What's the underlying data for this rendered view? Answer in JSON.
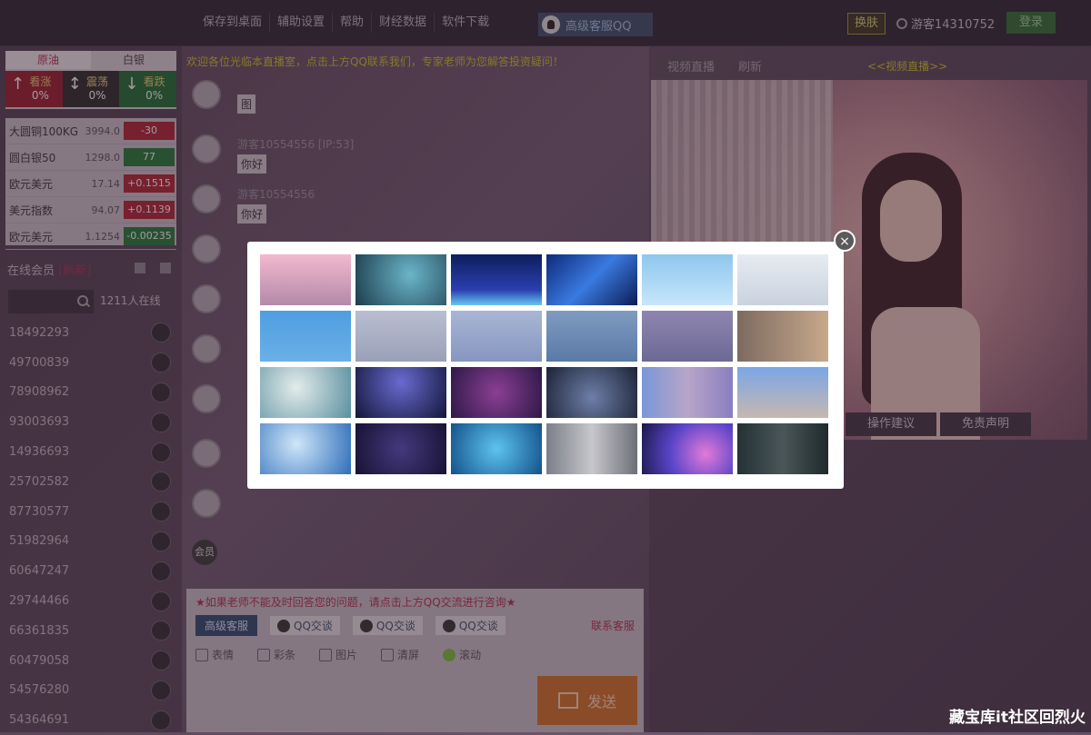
{
  "topbar": {
    "nav": [
      "保存到桌面",
      "辅助设置",
      "帮助",
      "财经数据",
      "软件下载"
    ],
    "qq_service": "高级客服QQ",
    "skin": "换肤",
    "user": "游客14310752",
    "login": "登录"
  },
  "quote": {
    "tabs": [
      "原油",
      "白银"
    ],
    "sentiment": [
      {
        "label": "看涨",
        "pct": "0%",
        "arrow": "↑"
      },
      {
        "label": "震荡",
        "pct": "0%",
        "arrow": "↕"
      },
      {
        "label": "看跌",
        "pct": "0%",
        "arrow": "↓"
      }
    ]
  },
  "markets": [
    {
      "name": "大圆铜100KG",
      "price": "3994.0",
      "change": "-30",
      "color": "red"
    },
    {
      "name": "圆白银50",
      "price": "1298.0",
      "change": "77",
      "color": "green"
    },
    {
      "name": "欧元美元",
      "price": "17.14",
      "change": "+0.1515",
      "color": "red"
    },
    {
      "name": "美元指数",
      "price": "94.07",
      "change": "+0.1139",
      "color": "red"
    },
    {
      "name": "欧元美元",
      "price": "1.1254",
      "change": "-0.00235",
      "color": "green"
    }
  ],
  "online": {
    "title": "在线会员",
    "title_tag": "[刷新]",
    "count": "1211人在线",
    "members": [
      "18492293",
      "49700839",
      "78908962",
      "93003693",
      "14936693",
      "25702582",
      "87730577",
      "51982964",
      "60647247",
      "29744466",
      "66361835",
      "60479058",
      "54576280",
      "54364691"
    ]
  },
  "chat": {
    "marquee": "欢迎各位光临本直播室，点击上方QQ联系我们，专家老师为您解答投资疑问！",
    "messages": [
      {
        "name": "",
        "text": "图"
      },
      {
        "name": "游客10554556 [IP:53]",
        "text": "你好"
      },
      {
        "name": "游客10554556",
        "text": "你好"
      }
    ],
    "member_label": "会员",
    "notice": "★如果老师不能及时回答您的问题，请点击上方QQ交流进行咨询★",
    "service_btn": "高级客服",
    "qq_chat": [
      "QQ交谈",
      "QQ交谈",
      "QQ交谈"
    ],
    "cs_link": "联系客服",
    "tools": [
      "表情",
      "彩条",
      "图片",
      "清屏",
      "滚动"
    ],
    "send": "发送"
  },
  "video": {
    "tabs": [
      "视频直播",
      "刷新"
    ],
    "title": "<<视频直播>>",
    "info_tabs": [
      "操作建议",
      "免责声明"
    ]
  },
  "skin_modal": {
    "close": "×",
    "thumbnails": 24
  },
  "watermark": "藏宝库it社区回烈火"
}
